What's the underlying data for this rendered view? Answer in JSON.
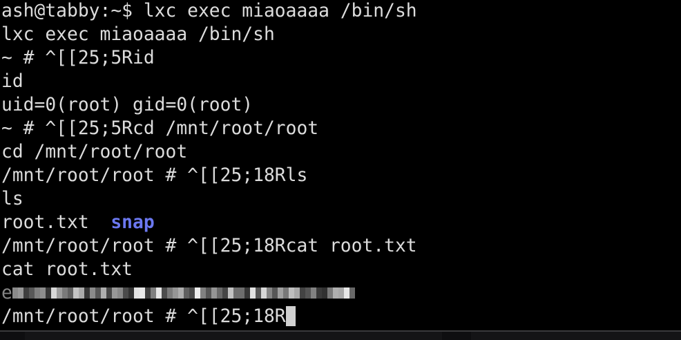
{
  "terminal": {
    "lines": [
      "ash@tabby:~$ lxc exec miaoaaaa /bin/sh",
      "lxc exec miaoaaaa /bin/sh",
      "~ # ^[[25;5Rid",
      "id",
      "uid=0(root) gid=0(root)",
      "~ # ^[[25;5Rcd /mnt/root/root",
      "cd /mnt/root/root",
      "/mnt/root/root # ^[[25;18Rls",
      "ls"
    ],
    "ls_output": {
      "file": "root.txt",
      "sep": "  ",
      "dir": "snap"
    },
    "lines2": [
      "/mnt/root/root # ^[[25;18Rcat root.txt",
      "cat root.txt"
    ],
    "redacted_prefix": "e",
    "prompt_last": "/mnt/root/root # ^[[25;18R"
  },
  "colors": {
    "text": "#dcdcdc",
    "directory": "#6b78f0",
    "background": "#000000"
  }
}
